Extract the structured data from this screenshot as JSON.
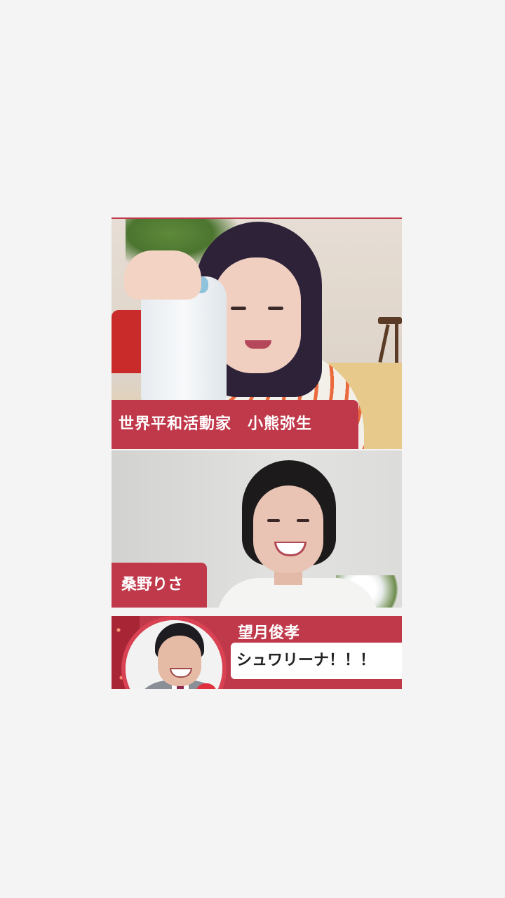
{
  "panels": {
    "top_video": {
      "name_tag": "世界平和活動家　小熊弥生"
    },
    "middle_video": {
      "name_tag": "桑野りさ"
    }
  },
  "comment_banner": {
    "author": "望月俊孝",
    "message": "シュワリーナ！！！"
  },
  "colors": {
    "accent": "#c0394a",
    "background": "#f4f4f4",
    "comment_text": "#222222"
  },
  "icons": [
    "avatar"
  ]
}
